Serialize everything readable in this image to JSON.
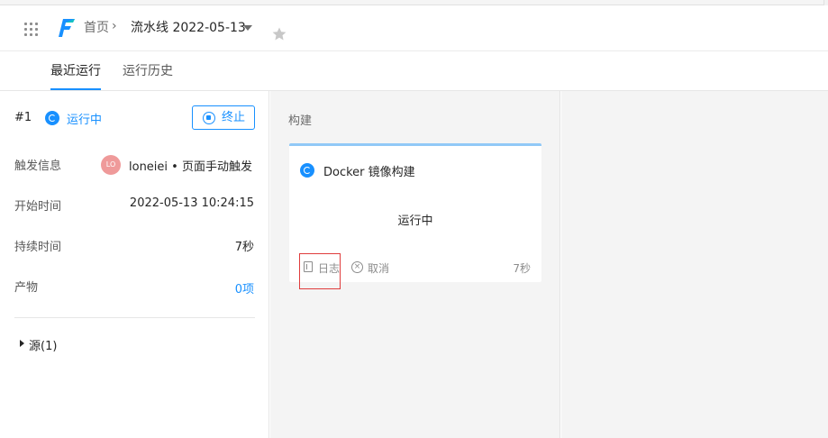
{
  "header": {
    "breadcrumb_home": "首页",
    "breadcrumb_sep": "›",
    "breadcrumb_current": "流水线 2022-05-13",
    "accent_color": "#1890ff"
  },
  "tabs": [
    {
      "label": "最近运行",
      "active": true
    },
    {
      "label": "运行历史",
      "active": false
    }
  ],
  "run": {
    "number": "#1",
    "status": "运行中",
    "stop_label": "终止",
    "rows": {
      "trigger_label": "触发信息",
      "trigger_avatar": "LO",
      "trigger_value": "loneiei • 页面手动触发",
      "start_label": "开始时间",
      "start_value": "2022-05-13 10:24:15",
      "duration_label": "持续时间",
      "duration_value": "7秒",
      "artifact_label": "产物",
      "artifact_value": "0项"
    },
    "source_label": "源(1)"
  },
  "stage": {
    "title": "构建",
    "job": {
      "name": "Docker 镜像构建",
      "state": "运行中",
      "log_label": "日志",
      "cancel_label": "取消",
      "duration": "7秒"
    }
  }
}
